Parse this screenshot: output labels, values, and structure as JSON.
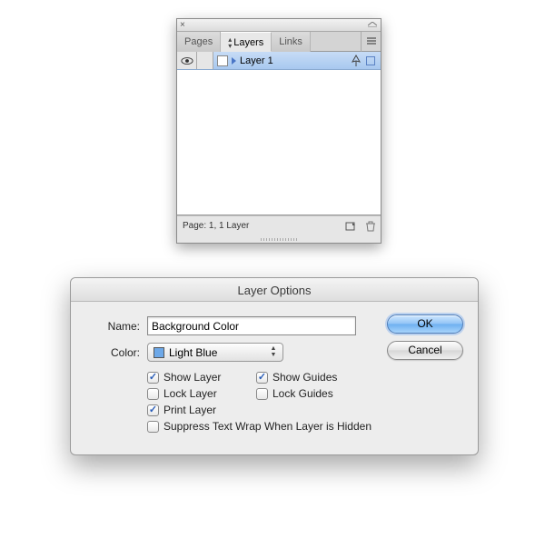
{
  "panel": {
    "tabs": {
      "pages": "Pages",
      "layers": "Layers",
      "links": "Links"
    },
    "layer": {
      "name": "Layer 1"
    },
    "status": "Page: 1, 1 Layer"
  },
  "dialog": {
    "title": "Layer Options",
    "labels": {
      "name": "Name:",
      "color": "Color:"
    },
    "values": {
      "name": "Background Color",
      "color": "Light Blue"
    },
    "checkboxes": {
      "show_layer": "Show Layer",
      "lock_layer": "Lock Layer",
      "print_layer": "Print Layer",
      "show_guides": "Show Guides",
      "lock_guides": "Lock Guides",
      "suppress": "Suppress Text Wrap When Layer is Hidden"
    },
    "buttons": {
      "ok": "OK",
      "cancel": "Cancel"
    }
  }
}
